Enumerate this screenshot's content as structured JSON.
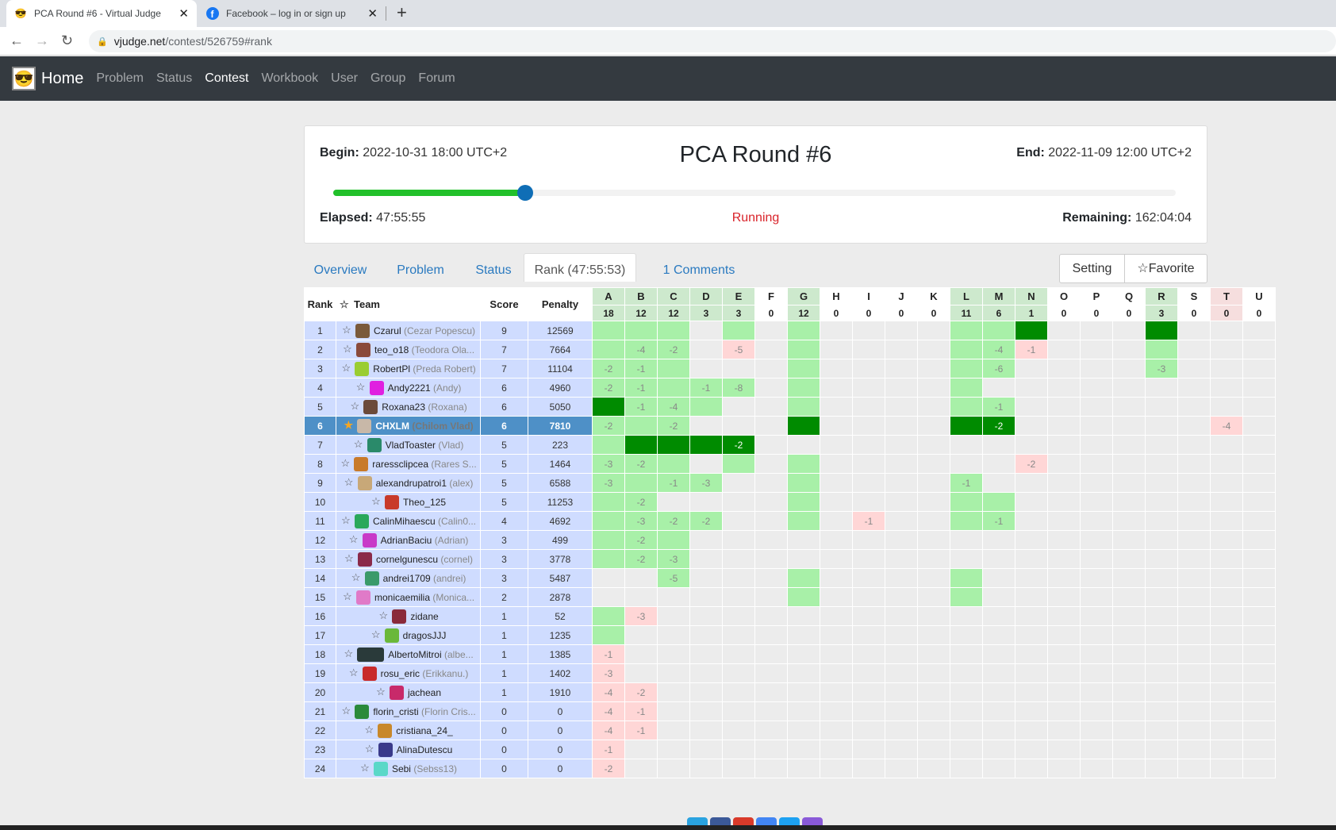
{
  "browser": {
    "tabs": [
      {
        "title": "PCA Round #6 - Virtual Judge",
        "active": true
      },
      {
        "title": "Facebook – log in or sign up",
        "active": false
      }
    ],
    "url_host": "vjudge.net",
    "url_path": "/contest/526759#rank"
  },
  "navbar": {
    "home": "Home",
    "items": [
      "Problem",
      "Status",
      "Contest",
      "Workbook",
      "User",
      "Group",
      "Forum"
    ]
  },
  "contest": {
    "title": "PCA Round #6",
    "begin_label": "Begin:",
    "begin": "2022-10-31 18:00 UTC+2",
    "end_label": "End:",
    "end": "2022-11-09 12:00 UTC+2",
    "elapsed_label": "Elapsed:",
    "elapsed": "47:55:55",
    "status": "Running",
    "remaining_label": "Remaining:",
    "remaining": "162:04:04",
    "progress_fraction": 0.228
  },
  "tabs": {
    "overview": "Overview",
    "problem": "Problem",
    "status": "Status",
    "rank": "Rank (47:55:53)",
    "comments": "1 Comments",
    "setting": "Setting",
    "favorite": "Favorite"
  },
  "table": {
    "headers": {
      "rank": "Rank",
      "team": "Team",
      "score": "Score",
      "penalty": "Penalty"
    },
    "problems": [
      "A",
      "B",
      "C",
      "D",
      "E",
      "F",
      "G",
      "H",
      "I",
      "J",
      "K",
      "L",
      "M",
      "N",
      "O",
      "P",
      "Q",
      "R",
      "S",
      "T",
      "U"
    ],
    "solved_counts": [
      "18",
      "12",
      "12",
      "3",
      "3",
      "0",
      "12",
      "0",
      "0",
      "0",
      "0",
      "11",
      "6",
      "1",
      "0",
      "0",
      "0",
      "3",
      "0",
      "0",
      "0"
    ],
    "rows": [
      {
        "rank": "1",
        "name": "Czarul",
        "nick": "(Cezar Popescu)",
        "score": "9",
        "penalty": "12569",
        "avatar": "#7a5a3a",
        "cells": [
          "ac",
          "ac",
          "ac",
          "",
          "ac",
          "",
          "ac",
          "",
          "",
          "",
          "",
          "ac",
          "ac",
          "fb",
          "",
          "",
          "",
          "fb",
          "",
          "",
          ""
        ]
      },
      {
        "rank": "2",
        "name": "teo_o18",
        "nick": "(Teodora Ola...",
        "score": "7",
        "penalty": "7664",
        "avatar": "#8a4a3a",
        "cells": [
          "ac",
          "-4",
          "-2",
          "",
          "-5",
          "",
          "ac",
          "",
          "",
          "",
          "",
          "ac",
          "-4",
          "-1",
          "",
          "",
          "",
          "ac",
          "",
          "",
          ""
        ]
      },
      {
        "rank": "3",
        "name": "RobertPl",
        "nick": "(Preda Robert)",
        "score": "7",
        "penalty": "11104",
        "avatar": "#9acd32",
        "cells": [
          "-2",
          "-1",
          "ac",
          "",
          "",
          "",
          "ac",
          "",
          "",
          "",
          "",
          "ac",
          "-6",
          "",
          "",
          "",
          "",
          "-3",
          "",
          "",
          ""
        ]
      },
      {
        "rank": "4",
        "name": "Andy2221",
        "nick": "(Andy)",
        "score": "6",
        "penalty": "4960",
        "avatar": "#e020e0",
        "cells": [
          "-2",
          "-1",
          "ac",
          "-1",
          "-8",
          "",
          "ac",
          "",
          "",
          "",
          "",
          "ac",
          "",
          "",
          "",
          "",
          "",
          "",
          "",
          "",
          ""
        ]
      },
      {
        "rank": "5",
        "name": "Roxana23",
        "nick": "(Roxana)",
        "score": "6",
        "penalty": "5050",
        "avatar": "#6b4a3a",
        "cells": [
          "fb",
          "-1",
          "-4",
          "ac",
          "",
          "",
          "ac",
          "",
          "",
          "",
          "",
          "ac",
          "-1",
          "",
          "",
          "",
          "",
          "",
          "",
          "",
          ""
        ]
      },
      {
        "rank": "6",
        "name": "CHXLM",
        "nick": "(Chilom Vlad)",
        "score": "6",
        "penalty": "7810",
        "avatar": "#c8b8a8",
        "me": true,
        "starred": true,
        "cells": [
          "-2",
          "ac",
          "-2",
          "",
          "",
          "",
          "fb",
          "",
          "",
          "",
          "",
          "fb",
          "-2f",
          "",
          "",
          "",
          "",
          "",
          "",
          "-4",
          ""
        ]
      },
      {
        "rank": "7",
        "name": "VladToaster",
        "nick": "(Vlad)",
        "score": "5",
        "penalty": "223",
        "avatar": "#2a8a6a",
        "cells": [
          "ac",
          "fb",
          "fb",
          "fb",
          "-2f",
          "",
          "",
          "",
          "",
          "",
          "",
          "",
          "",
          "",
          "",
          "",
          "",
          "",
          "",
          "",
          ""
        ]
      },
      {
        "rank": "8",
        "name": "raressclipcea",
        "nick": "(Rares S...",
        "score": "5",
        "penalty": "1464",
        "avatar": "#c87a2a",
        "cells": [
          "-3",
          "-2",
          "ac",
          "",
          "ac",
          "",
          "ac",
          "",
          "",
          "",
          "",
          "",
          "",
          "-2",
          "",
          "",
          "",
          "",
          "",
          "",
          ""
        ]
      },
      {
        "rank": "9",
        "name": "alexandrupatroi1",
        "nick": "(alex)",
        "score": "5",
        "penalty": "6588",
        "avatar": "#c8a878",
        "cells": [
          "-3",
          "ac",
          "-1",
          "-3",
          "",
          "",
          "ac",
          "",
          "",
          "",
          "",
          "-1",
          "",
          "",
          "",
          "",
          "",
          "",
          "",
          "",
          ""
        ]
      },
      {
        "rank": "10",
        "name": "Theo_125",
        "nick": "",
        "score": "5",
        "penalty": "11253",
        "avatar": "#c83a2a",
        "cells": [
          "ac",
          "-2",
          "",
          "",
          "",
          "",
          "ac",
          "",
          "",
          "",
          "",
          "ac",
          "ac",
          "",
          "",
          "",
          "",
          "",
          "",
          "",
          ""
        ]
      },
      {
        "rank": "11",
        "name": "CalinMihaescu",
        "nick": "(Calin0...",
        "score": "4",
        "penalty": "4692",
        "avatar": "#2aa85a",
        "cells": [
          "ac",
          "-3",
          "-2",
          "-2",
          "",
          "",
          "ac",
          "",
          "-1",
          "",
          "",
          "ac",
          "-1",
          "",
          "",
          "",
          "",
          "",
          "",
          "",
          ""
        ]
      },
      {
        "rank": "12",
        "name": "AdrianBaciu",
        "nick": "(Adrian)",
        "score": "3",
        "penalty": "499",
        "avatar": "#c83ac8",
        "cells": [
          "ac",
          "-2",
          "ac",
          "",
          "",
          "",
          "",
          "",
          "",
          "",
          "",
          "",
          "",
          "",
          "",
          "",
          "",
          "",
          "",
          "",
          ""
        ]
      },
      {
        "rank": "13",
        "name": "cornelgunescu",
        "nick": "(cornel)",
        "score": "3",
        "penalty": "3778",
        "avatar": "#8a2a4a",
        "cells": [
          "ac",
          "-2",
          "-3",
          "",
          "",
          "",
          "",
          "",
          "",
          "",
          "",
          "",
          "",
          "",
          "",
          "",
          "",
          "",
          "",
          "",
          ""
        ]
      },
      {
        "rank": "14",
        "name": "andrei1709",
        "nick": "(andrei)",
        "score": "3",
        "penalty": "5487",
        "avatar": "#3a9a6a",
        "cells": [
          "",
          "",
          "-5",
          "",
          "",
          "",
          "ac",
          "",
          "",
          "",
          "",
          "ac",
          "",
          "",
          "",
          "",
          "",
          "",
          "",
          "",
          ""
        ]
      },
      {
        "rank": "15",
        "name": "monicaemilia",
        "nick": "(Monica...",
        "score": "2",
        "penalty": "2878",
        "avatar": "#e07ac8",
        "cells": [
          "",
          "",
          "",
          "",
          "",
          "",
          "ac",
          "",
          "",
          "",
          "",
          "ac",
          "",
          "",
          "",
          "",
          "",
          "",
          "",
          "",
          ""
        ]
      },
      {
        "rank": "16",
        "name": "zidane",
        "nick": "",
        "score": "1",
        "penalty": "52",
        "avatar": "#8a2a3a",
        "cells": [
          "ac",
          "-3",
          "",
          "",
          "",
          "",
          "",
          "",
          "",
          "",
          "",
          "",
          "",
          "",
          "",
          "",
          "",
          "",
          "",
          "",
          ""
        ]
      },
      {
        "rank": "17",
        "name": "dragosJJJ",
        "nick": "",
        "score": "1",
        "penalty": "1235",
        "avatar": "#6ab83a",
        "cells": [
          "ac",
          "",
          "",
          "",
          "",
          "",
          "",
          "",
          "",
          "",
          "",
          "",
          "",
          "",
          "",
          "",
          "",
          "",
          "",
          "",
          ""
        ]
      },
      {
        "rank": "18",
        "name": "AlbertoMitroi",
        "nick": "(albe...",
        "score": "1",
        "penalty": "1385",
        "avatar": "#2a3a3a",
        "wide": true,
        "cells": [
          "-1",
          "",
          "",
          "",
          "",
          "",
          "",
          "",
          "",
          "",
          "",
          "",
          "",
          "",
          "",
          "",
          "",
          "",
          "",
          "",
          ""
        ]
      },
      {
        "rank": "19",
        "name": "rosu_eric",
        "nick": "(Erikkanu.)",
        "score": "1",
        "penalty": "1402",
        "avatar": "#c82a2a",
        "cells": [
          "-3",
          "",
          "",
          "",
          "",
          "",
          "",
          "",
          "",
          "",
          "",
          "",
          "",
          "",
          "",
          "",
          "",
          "",
          "",
          "",
          ""
        ]
      },
      {
        "rank": "20",
        "name": "jachean",
        "nick": "",
        "score": "1",
        "penalty": "1910",
        "avatar": "#c82a6a",
        "cells": [
          "-4",
          "-2",
          "",
          "",
          "",
          "",
          "",
          "",
          "",
          "",
          "",
          "",
          "",
          "",
          "",
          "",
          "",
          "",
          "",
          "",
          ""
        ]
      },
      {
        "rank": "21",
        "name": "florin_cristi",
        "nick": "(Florin Cris...",
        "score": "0",
        "penalty": "0",
        "avatar": "#2a8a3a",
        "cells": [
          "-4",
          "-1",
          "",
          "",
          "",
          "",
          "",
          "",
          "",
          "",
          "",
          "",
          "",
          "",
          "",
          "",
          "",
          "",
          "",
          "",
          ""
        ]
      },
      {
        "rank": "22",
        "name": "cristiana_24_",
        "nick": "",
        "score": "0",
        "penalty": "0",
        "avatar": "#c8882a",
        "cells": [
          "-4",
          "-1",
          "",
          "",
          "",
          "",
          "",
          "",
          "",
          "",
          "",
          "",
          "",
          "",
          "",
          "",
          "",
          "",
          "",
          "",
          ""
        ]
      },
      {
        "rank": "23",
        "name": "AlinaDutescu",
        "nick": "",
        "score": "0",
        "penalty": "0",
        "avatar": "#3a3a8a",
        "cells": [
          "-1",
          "",
          "",
          "",
          "",
          "",
          "",
          "",
          "",
          "",
          "",
          "",
          "",
          "",
          "",
          "",
          "",
          "",
          "",
          "",
          ""
        ]
      },
      {
        "rank": "24",
        "name": "Sebi",
        "nick": "(Sebss13)",
        "score": "0",
        "penalty": "0",
        "avatar": "#5ad8c8",
        "cells": [
          "-2",
          "",
          "",
          "",
          "",
          "",
          "",
          "",
          "",
          "",
          "",
          "",
          "",
          "",
          "",
          "",
          "",
          "",
          "",
          "",
          ""
        ]
      }
    ]
  }
}
